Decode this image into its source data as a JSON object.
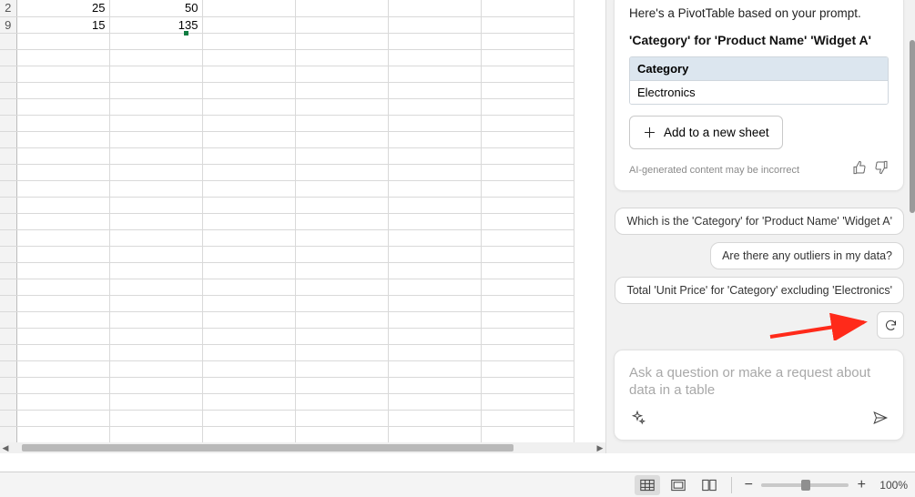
{
  "sheet": {
    "rows": [
      {
        "hdr": "2",
        "a": "25",
        "b": "50"
      },
      {
        "hdr": "9",
        "a": "15",
        "b": "135"
      }
    ]
  },
  "copilot": {
    "card": {
      "intro": "Here's a PivotTable based on your prompt.",
      "title": "'Category' for 'Product Name' 'Widget A'",
      "pivot": {
        "header": "Category",
        "value": "Electronics"
      },
      "add_btn": "Add to a new sheet",
      "disclaimer": "AI-generated content may be incorrect"
    },
    "suggestions": [
      "Which is the 'Category' for 'Product Name' 'Widget A'",
      "Are there any outliers in my data?",
      "Total 'Unit Price' for 'Category' excluding 'Electronics'"
    ],
    "prompt_placeholder": "Ask a question or make a request about data in a table"
  },
  "status": {
    "zoom": "100%"
  }
}
